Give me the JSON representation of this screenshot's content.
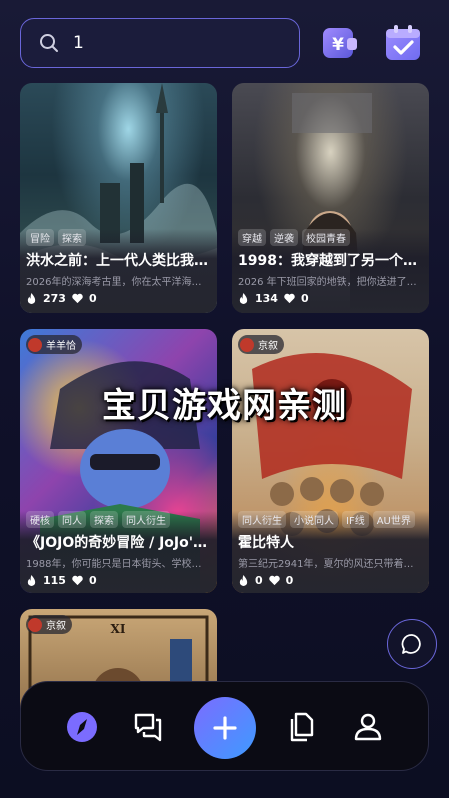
{
  "search": {
    "value": "1"
  },
  "cards": [
    {
      "tags": [
        "冒险",
        "探索"
      ],
      "title": "洪水之前：上一代人类比我…",
      "desc": "2026年的深海考古里，你在太平洋海…",
      "fire": "273",
      "likes": "0"
    },
    {
      "tags": [
        "穿越",
        "逆袭",
        "校园青春"
      ],
      "title": "1998：我穿越到了另一个…",
      "desc": "2026 年下班回家的地铁，把你送进了…",
      "fire": "134",
      "likes": "0"
    },
    {
      "author": "羊羊恰",
      "tags": [
        "硬核",
        "同人",
        "探索",
        "同人衍生"
      ],
      "title": "《JOJO的奇妙冒险 / JoJo'…",
      "desc": "1988年，你可能只是日本街头、学校…",
      "fire": "115",
      "likes": "0"
    },
    {
      "author": "京叙",
      "tags": [
        "同人衍生",
        "小说同人",
        "IF线",
        "AU世界"
      ],
      "title": "霍比特人",
      "desc": "第三纪元2941年，夏尔的风还只带着…",
      "fire": "0",
      "likes": "0"
    },
    {
      "author": "京叙"
    }
  ],
  "watermark": "宝贝游戏网亲测",
  "icons": {
    "search": "search-icon",
    "wallet": "yen-wallet-icon",
    "checkin": "calendar-check-icon",
    "fire": "fire-icon",
    "heart": "heart-icon",
    "chat": "chat-bubble-icon",
    "nav": [
      "compass-icon",
      "messages-icon",
      "plus-icon",
      "documents-icon",
      "profile-icon"
    ]
  },
  "colors": {
    "accent": "#6a66d9",
    "nav_active": "#7b6cff"
  }
}
